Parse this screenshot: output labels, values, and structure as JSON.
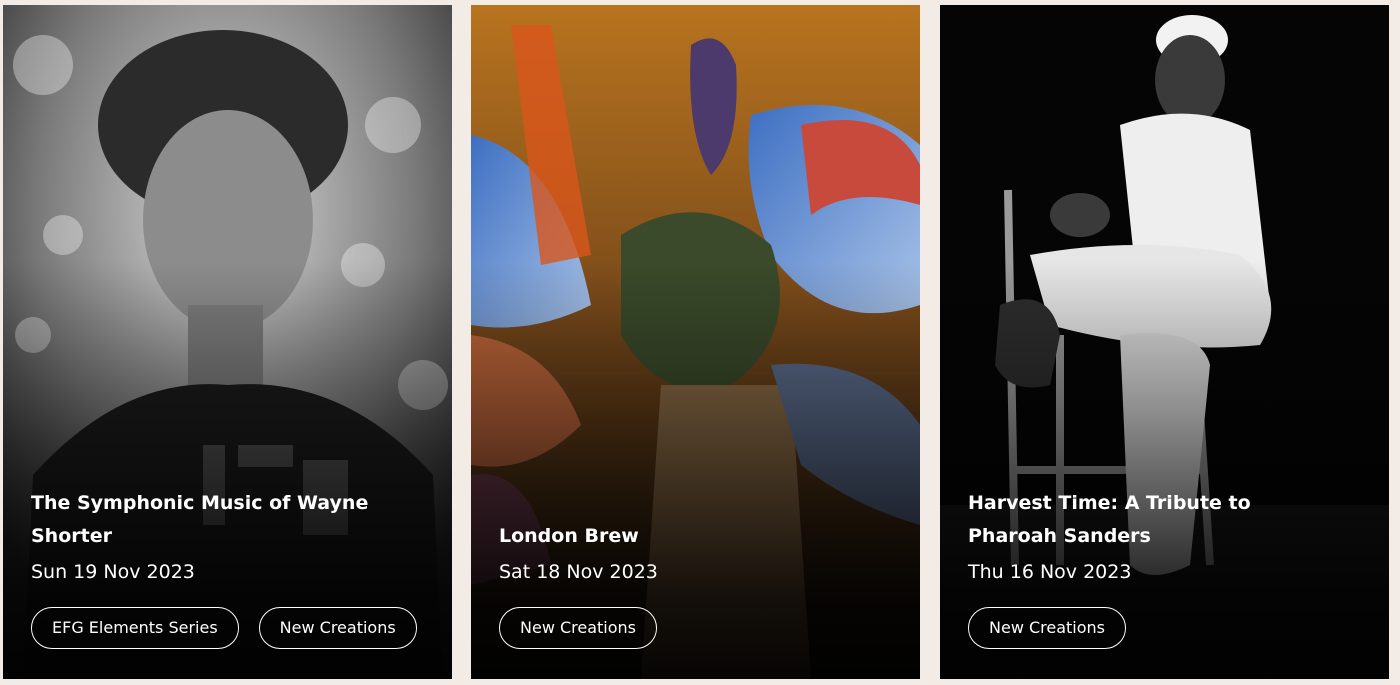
{
  "events": [
    {
      "title": "The Symphonic Music of Wayne Shorter",
      "date": "Sun 19 Nov 2023",
      "tags": [
        "EFG Elements Series",
        "New Creations"
      ]
    },
    {
      "title": "London Brew",
      "date": "Sat 18 Nov 2023",
      "tags": [
        "New Creations"
      ]
    },
    {
      "title": "Harvest Time: A Tribute to Pharoah Sanders",
      "date": "Thu 16 Nov 2023",
      "tags": [
        "New Creations"
      ]
    }
  ],
  "colors": {
    "page_background": "#f3ebe5",
    "text": "#ffffff",
    "card_dark": "#000000"
  }
}
